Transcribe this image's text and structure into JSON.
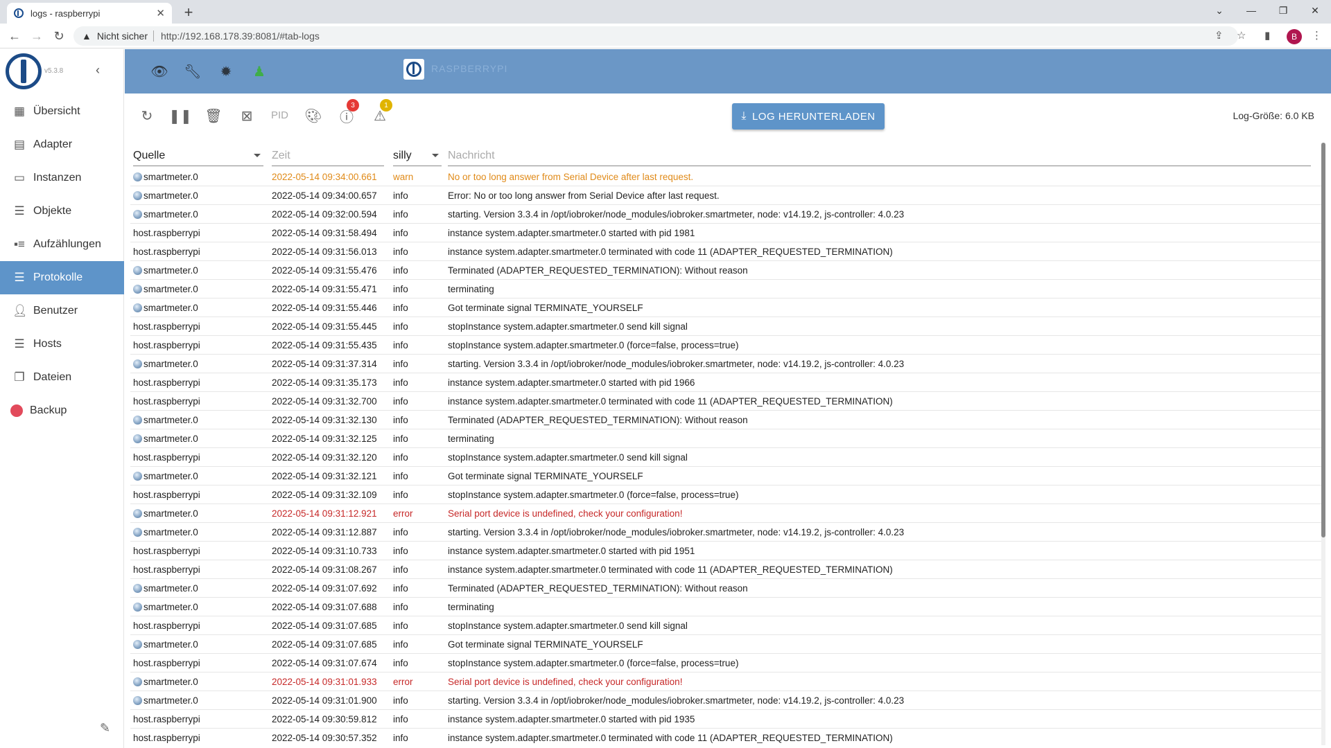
{
  "browser": {
    "tab_title": "logs - raspberrypi",
    "new_tab": "+",
    "not_secure": "Nicht sicher",
    "url": "http://192.168.178.39:8081/#tab-logs",
    "profile_initial": "B"
  },
  "sidebar": {
    "version": "v5.3.8",
    "items": [
      {
        "label": "Übersicht",
        "icon": "grid-icon"
      },
      {
        "label": "Adapter",
        "icon": "store-icon"
      },
      {
        "label": "Instanzen",
        "icon": "instances-icon"
      },
      {
        "label": "Objekte",
        "icon": "list-icon"
      },
      {
        "label": "Aufzählungen",
        "icon": "enum-icon"
      },
      {
        "label": "Protokolle",
        "icon": "logs-icon",
        "active": true
      },
      {
        "label": "Benutzer",
        "icon": "user-icon"
      },
      {
        "label": "Hosts",
        "icon": "hosts-icon"
      },
      {
        "label": "Dateien",
        "icon": "files-icon"
      },
      {
        "label": "Backup",
        "icon": "backup-icon"
      }
    ]
  },
  "appbar": {
    "host_name": "RASPBERRYPI"
  },
  "toolbar": {
    "pid_label": "PID",
    "error_count": "3",
    "warn_count": "1",
    "download_label": "LOG HERUNTERLADEN",
    "log_size": "Log-Größe: 6.0 KB"
  },
  "table": {
    "col_source": "Quelle",
    "col_time_placeholder": "Zeit",
    "col_severity": "silly",
    "col_message_placeholder": "Nachricht",
    "rows": [
      {
        "src": "smartmeter.0",
        "adapter": true,
        "time": "2022-05-14 09:34:00.661",
        "sev": "warn",
        "msg": "No or too long answer from Serial Device after last request."
      },
      {
        "src": "smartmeter.0",
        "adapter": true,
        "time": "2022-05-14 09:34:00.657",
        "sev": "info",
        "msg": "Error: No or too long answer from Serial Device after last request."
      },
      {
        "src": "smartmeter.0",
        "adapter": true,
        "time": "2022-05-14 09:32:00.594",
        "sev": "info",
        "msg": "starting. Version 3.3.4 in /opt/iobroker/node_modules/iobroker.smartmeter, node: v14.19.2, js-controller: 4.0.23"
      },
      {
        "src": "host.raspberrypi",
        "adapter": false,
        "time": "2022-05-14 09:31:58.494",
        "sev": "info",
        "msg": "instance system.adapter.smartmeter.0 started with pid 1981"
      },
      {
        "src": "host.raspberrypi",
        "adapter": false,
        "time": "2022-05-14 09:31:56.013",
        "sev": "info",
        "msg": "instance system.adapter.smartmeter.0 terminated with code 11 (ADAPTER_REQUESTED_TERMINATION)"
      },
      {
        "src": "smartmeter.0",
        "adapter": true,
        "time": "2022-05-14 09:31:55.476",
        "sev": "info",
        "msg": "Terminated (ADAPTER_REQUESTED_TERMINATION): Without reason"
      },
      {
        "src": "smartmeter.0",
        "adapter": true,
        "time": "2022-05-14 09:31:55.471",
        "sev": "info",
        "msg": "terminating"
      },
      {
        "src": "smartmeter.0",
        "adapter": true,
        "time": "2022-05-14 09:31:55.446",
        "sev": "info",
        "msg": "Got terminate signal TERMINATE_YOURSELF"
      },
      {
        "src": "host.raspberrypi",
        "adapter": false,
        "time": "2022-05-14 09:31:55.445",
        "sev": "info",
        "msg": "stopInstance system.adapter.smartmeter.0 send kill signal"
      },
      {
        "src": "host.raspberrypi",
        "adapter": false,
        "time": "2022-05-14 09:31:55.435",
        "sev": "info",
        "msg": "stopInstance system.adapter.smartmeter.0 (force=false, process=true)"
      },
      {
        "src": "smartmeter.0",
        "adapter": true,
        "time": "2022-05-14 09:31:37.314",
        "sev": "info",
        "msg": "starting. Version 3.3.4 in /opt/iobroker/node_modules/iobroker.smartmeter, node: v14.19.2, js-controller: 4.0.23"
      },
      {
        "src": "host.raspberrypi",
        "adapter": false,
        "time": "2022-05-14 09:31:35.173",
        "sev": "info",
        "msg": "instance system.adapter.smartmeter.0 started with pid 1966"
      },
      {
        "src": "host.raspberrypi",
        "adapter": false,
        "time": "2022-05-14 09:31:32.700",
        "sev": "info",
        "msg": "instance system.adapter.smartmeter.0 terminated with code 11 (ADAPTER_REQUESTED_TERMINATION)"
      },
      {
        "src": "smartmeter.0",
        "adapter": true,
        "time": "2022-05-14 09:31:32.130",
        "sev": "info",
        "msg": "Terminated (ADAPTER_REQUESTED_TERMINATION): Without reason"
      },
      {
        "src": "smartmeter.0",
        "adapter": true,
        "time": "2022-05-14 09:31:32.125",
        "sev": "info",
        "msg": "terminating"
      },
      {
        "src": "host.raspberrypi",
        "adapter": false,
        "time": "2022-05-14 09:31:32.120",
        "sev": "info",
        "msg": "stopInstance system.adapter.smartmeter.0 send kill signal"
      },
      {
        "src": "smartmeter.0",
        "adapter": true,
        "time": "2022-05-14 09:31:32.121",
        "sev": "info",
        "msg": "Got terminate signal TERMINATE_YOURSELF"
      },
      {
        "src": "host.raspberrypi",
        "adapter": false,
        "time": "2022-05-14 09:31:32.109",
        "sev": "info",
        "msg": "stopInstance system.adapter.smartmeter.0 (force=false, process=true)"
      },
      {
        "src": "smartmeter.0",
        "adapter": true,
        "time": "2022-05-14 09:31:12.921",
        "sev": "error",
        "msg": "Serial port device is undefined, check your configuration!"
      },
      {
        "src": "smartmeter.0",
        "adapter": true,
        "time": "2022-05-14 09:31:12.887",
        "sev": "info",
        "msg": "starting. Version 3.3.4 in /opt/iobroker/node_modules/iobroker.smartmeter, node: v14.19.2, js-controller: 4.0.23"
      },
      {
        "src": "host.raspberrypi",
        "adapter": false,
        "time": "2022-05-14 09:31:10.733",
        "sev": "info",
        "msg": "instance system.adapter.smartmeter.0 started with pid 1951"
      },
      {
        "src": "host.raspberrypi",
        "adapter": false,
        "time": "2022-05-14 09:31:08.267",
        "sev": "info",
        "msg": "instance system.adapter.smartmeter.0 terminated with code 11 (ADAPTER_REQUESTED_TERMINATION)"
      },
      {
        "src": "smartmeter.0",
        "adapter": true,
        "time": "2022-05-14 09:31:07.692",
        "sev": "info",
        "msg": "Terminated (ADAPTER_REQUESTED_TERMINATION): Without reason"
      },
      {
        "src": "smartmeter.0",
        "adapter": true,
        "time": "2022-05-14 09:31:07.688",
        "sev": "info",
        "msg": "terminating"
      },
      {
        "src": "host.raspberrypi",
        "adapter": false,
        "time": "2022-05-14 09:31:07.685",
        "sev": "info",
        "msg": "stopInstance system.adapter.smartmeter.0 send kill signal"
      },
      {
        "src": "smartmeter.0",
        "adapter": true,
        "time": "2022-05-14 09:31:07.685",
        "sev": "info",
        "msg": "Got terminate signal TERMINATE_YOURSELF"
      },
      {
        "src": "host.raspberrypi",
        "adapter": false,
        "time": "2022-05-14 09:31:07.674",
        "sev": "info",
        "msg": "stopInstance system.adapter.smartmeter.0 (force=false, process=true)"
      },
      {
        "src": "smartmeter.0",
        "adapter": true,
        "time": "2022-05-14 09:31:01.933",
        "sev": "error",
        "msg": "Serial port device is undefined, check your configuration!"
      },
      {
        "src": "smartmeter.0",
        "adapter": true,
        "time": "2022-05-14 09:31:01.900",
        "sev": "info",
        "msg": "starting. Version 3.3.4 in /opt/iobroker/node_modules/iobroker.smartmeter, node: v14.19.2, js-controller: 4.0.23"
      },
      {
        "src": "host.raspberrypi",
        "adapter": false,
        "time": "2022-05-14 09:30:59.812",
        "sev": "info",
        "msg": "instance system.adapter.smartmeter.0 started with pid 1935"
      },
      {
        "src": "host.raspberrypi",
        "adapter": false,
        "time": "2022-05-14 09:30:57.352",
        "sev": "info",
        "msg": "instance system.adapter.smartmeter.0 terminated with code 11 (ADAPTER_REQUESTED_TERMINATION)"
      }
    ]
  },
  "colors": {
    "appbar": "#6b97c6",
    "accent": "#5e94c9",
    "warn": "#e08a18",
    "error": "#c62828",
    "error_badge": "#e53935",
    "warn_badge": "#e0b400"
  }
}
